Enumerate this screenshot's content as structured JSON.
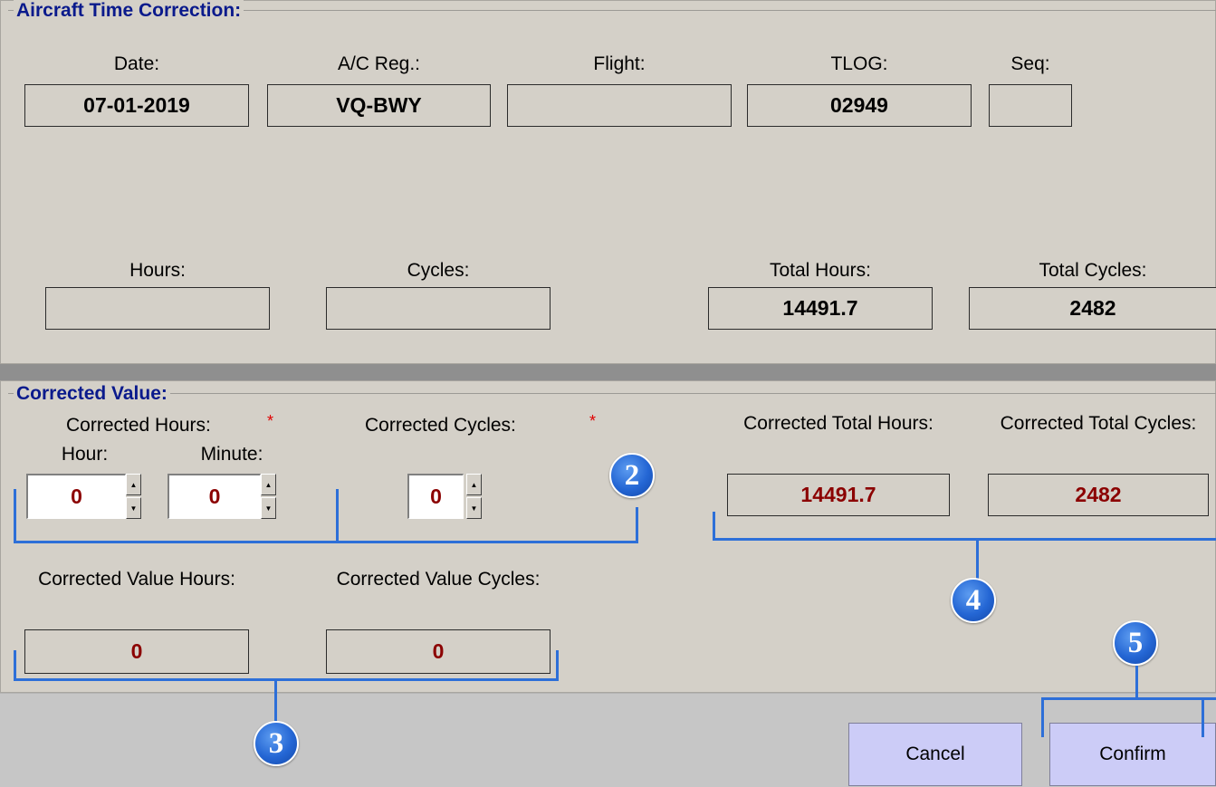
{
  "aircraft_section": {
    "title": "Aircraft Time Correction:",
    "date_label": "Date:",
    "date_value": "07-01-2019",
    "reg_label": "A/C Reg.:",
    "reg_value": "VQ-BWY",
    "flight_label": "Flight:",
    "flight_value": "",
    "tlog_label": "TLOG:",
    "tlog_value": "02949",
    "seq_label": "Seq:",
    "seq_value": "",
    "hours_label": "Hours:",
    "hours_value": "",
    "cycles_label": "Cycles:",
    "cycles_value": "",
    "total_hours_label": "Total Hours:",
    "total_hours_value": "14491.7",
    "total_cycles_label": "Total Cycles:",
    "total_cycles_value": "2482"
  },
  "corrected_section": {
    "title": "Corrected Value:",
    "corrected_hours_label": "Corrected Hours:",
    "required_mark": "*",
    "hour_label": "Hour:",
    "hour_value": "0",
    "minute_label": "Minute:",
    "minute_value": "0",
    "corrected_cycles_label": "Corrected Cycles:",
    "cycles_value": "0",
    "corrected_total_hours_label": "Corrected Total Hours:",
    "corrected_total_hours_value": "14491.7",
    "corrected_total_cycles_label": "Corrected Total Cycles:",
    "corrected_total_cycles_value": "2482",
    "corrected_value_hours_label": "Corrected Value Hours:",
    "corrected_value_hours_value": "0",
    "corrected_value_cycles_label": "Corrected Value Cycles:",
    "corrected_value_cycles_value": "0"
  },
  "buttons": {
    "cancel_label": "Cancel",
    "confirm_label": "Confirm"
  },
  "callouts": {
    "two": "2",
    "three": "3",
    "four": "4",
    "five": "5"
  },
  "icons": {
    "spin_up": "arrow-up-icon",
    "spin_down": "arrow-down-icon"
  },
  "colors": {
    "group_title": "#0a1a8c",
    "corrected_value_text": "#8b0000",
    "required_mark": "#e00000",
    "callout_blue": "#2466d4",
    "button_bg": "#ccccf7"
  }
}
